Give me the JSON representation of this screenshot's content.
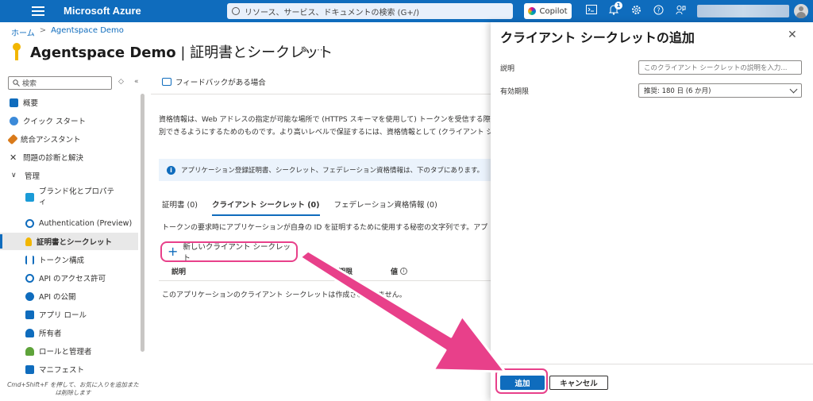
{
  "colors": {
    "accent": "#0f6cbd",
    "highlight": "#e8408a",
    "panel_bg": "#ffffff"
  },
  "topbar": {
    "brand": "Microsoft Azure",
    "search_placeholder": "リソース、サービス、ドキュメントの検索 (G+/)",
    "copilot": "Copilot",
    "notification_count": "1",
    "icons": [
      "hamburger-icon",
      "search-icon",
      "copilot-icon",
      "terminal-icon",
      "bell-icon",
      "gear-icon",
      "help-icon",
      "feedback-icon",
      "avatar"
    ]
  },
  "breadcrumb": {
    "home": "ホーム",
    "app": "Agentspace Demo"
  },
  "page": {
    "title_app": "Agentspace Demo",
    "title_sep": " | ",
    "title_section": "証明書とシークレット",
    "more": "···"
  },
  "sidebar": {
    "search_placeholder": "検索",
    "items": [
      {
        "label": "概要",
        "icon": "overview-icon",
        "color": "#0f6cbd"
      },
      {
        "label": "クイック スタート",
        "icon": "cloud-icon",
        "color": "#3b8ad9"
      },
      {
        "label": "統合アシスタント",
        "icon": "rocket-icon",
        "color": "#d97a1a"
      },
      {
        "label": "問題の診断と解決",
        "icon": "wrench-icon",
        "color": "#333333"
      },
      {
        "label": "管理",
        "icon": "chevron-down-icon",
        "color": "#333333"
      },
      {
        "label": "ブランド化とプロパティ",
        "icon": "branding-icon",
        "color": "#1a9bd7"
      },
      {
        "label": "Authentication (Preview)",
        "icon": "auth-icon",
        "color": "#0f6cbd"
      },
      {
        "label": "証明書とシークレット",
        "icon": "key-icon",
        "color": "#f2b600"
      },
      {
        "label": "トークン構成",
        "icon": "token-icon",
        "color": "#0f6cbd"
      },
      {
        "label": "API のアクセス許可",
        "icon": "api-permission-icon",
        "color": "#0f6cbd"
      },
      {
        "label": "API の公開",
        "icon": "api-expose-icon",
        "color": "#0f6cbd"
      },
      {
        "label": "アプリ ロール",
        "icon": "app-roles-icon",
        "color": "#0f6cbd"
      },
      {
        "label": "所有者",
        "icon": "owners-icon",
        "color": "#0f6cbd"
      },
      {
        "label": "ロールと管理者",
        "icon": "roles-admins-icon",
        "color": "#5ea33a"
      },
      {
        "label": "マニフェスト",
        "icon": "manifest-icon",
        "color": "#0f6cbd"
      }
    ],
    "footer": "Cmd+Shift+F を押して、お気に入りを追加または削除します"
  },
  "main": {
    "feedback": "フィードバックがある場合",
    "description_line1": "資格情報は、Web アドレスの指定が可能な場所で (HTTPS スキーマを使用して) トークンを受信する際に",
    "description_line2": "別できるようにするためのものです。より高いレベルで保証するには、資格情報として (クライアント シ",
    "info": "アプリケーション登録証明書、シークレット、フェデレーション資格情報は、下のタブにあります。",
    "tabs": [
      {
        "label": "証明書 (0)"
      },
      {
        "label": "クライアント シークレット (0)"
      },
      {
        "label": "フェデレーション資格情報 (0)"
      }
    ],
    "tab_description": "トークンの要求時にアプリケーションが自身の ID を証明するために使用する秘密の文字列です。アプ",
    "new_secret": "新しいクライアント シークレット",
    "columns": [
      "説明",
      "有効期限",
      "値"
    ],
    "empty": "このアプリケーションのクライアント シークレットは作成されていません。"
  },
  "panel": {
    "title": "クライアント シークレットの追加",
    "description_label": "説明",
    "description_placeholder": "このクライアント シークレットの説明を入力...",
    "expiry_label": "有効期限",
    "expiry_value": "推奨: 180 日 (6 か月)",
    "add": "追加",
    "cancel": "キャンセル"
  }
}
